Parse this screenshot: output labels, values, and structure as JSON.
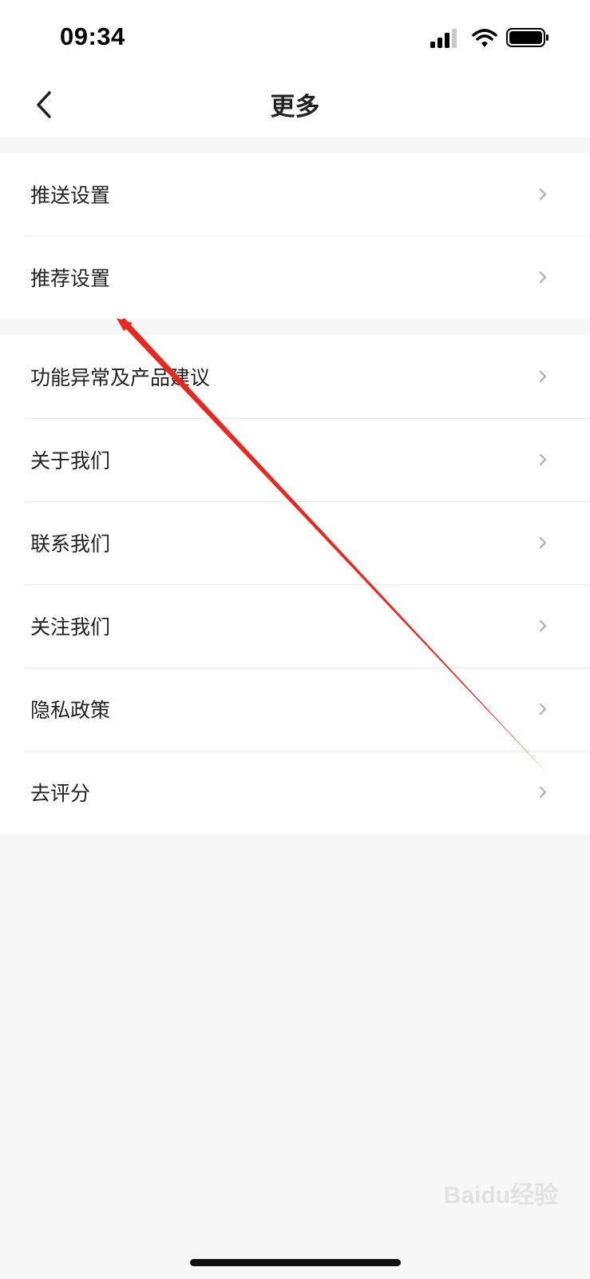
{
  "status_bar": {
    "time": "09:34"
  },
  "nav": {
    "title": "更多",
    "back_icon": "chevron-left-icon"
  },
  "groups": [
    {
      "items": [
        {
          "label": "推送设置"
        },
        {
          "label": "推荐设置"
        }
      ]
    },
    {
      "items": [
        {
          "label": "功能异常及产品建议"
        },
        {
          "label": "关于我们"
        },
        {
          "label": "联系我们"
        },
        {
          "label": "关注我们"
        },
        {
          "label": "隐私政策"
        },
        {
          "label": "去评分"
        }
      ]
    }
  ],
  "annotation": {
    "color": "#e8281e"
  },
  "watermark": {
    "text": "Baidu经验"
  }
}
